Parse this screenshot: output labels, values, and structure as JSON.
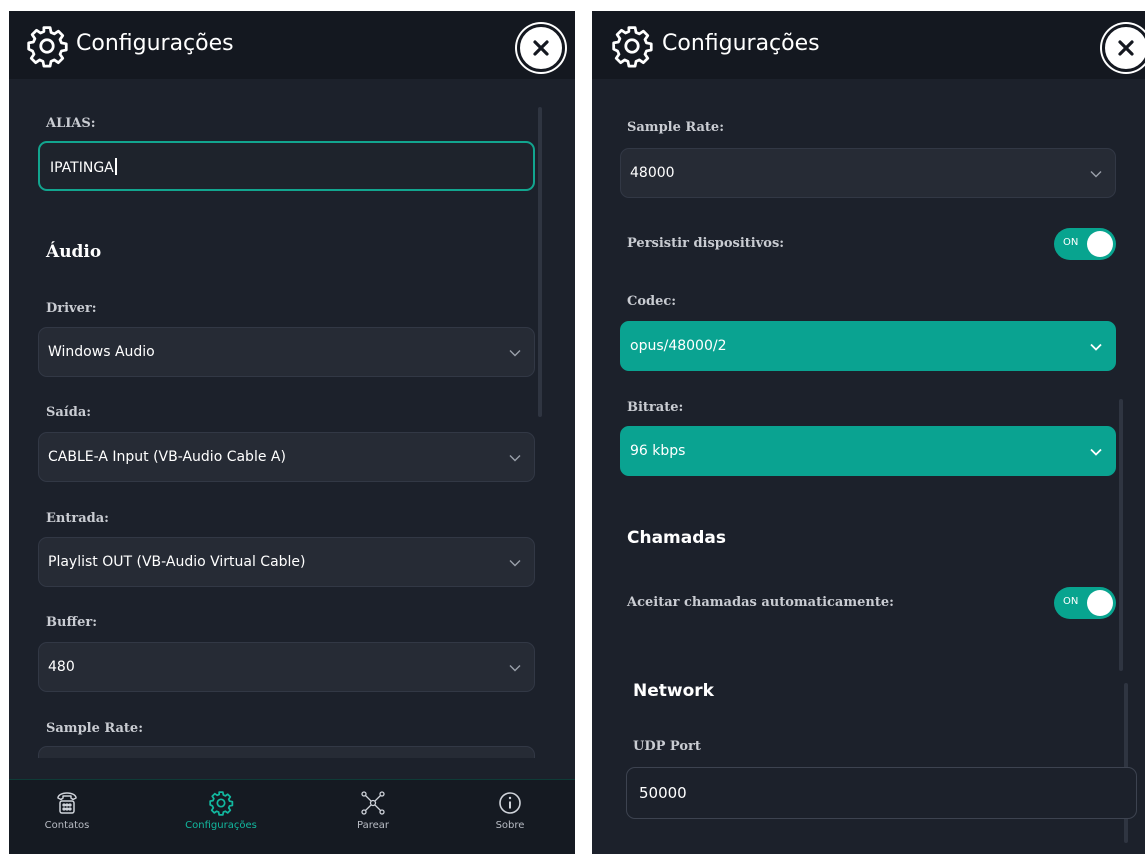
{
  "left": {
    "header": {
      "title": "Configurações",
      "icon": "gear-icon",
      "close_icon": "close-icon"
    },
    "alias": {
      "label": "ALIAS:",
      "value": "IPATINGA"
    },
    "audio_section": "Áudio",
    "driver": {
      "label": "Driver:",
      "value": "Windows Audio"
    },
    "saida": {
      "label": "Saída:",
      "value": "CABLE-A Input (VB-Audio Cable A)"
    },
    "entrada": {
      "label": "Entrada:",
      "value": "Playlist OUT (VB-Audio Virtual Cable)"
    },
    "buffer": {
      "label": "Buffer:",
      "value": "480"
    },
    "sample_rate": {
      "label": "Sample Rate:"
    },
    "nav": [
      {
        "label": "Contatos",
        "icon": "phone-icon",
        "active": false
      },
      {
        "label": "Configurações",
        "icon": "gear-icon",
        "active": true
      },
      {
        "label": "Parear",
        "icon": "network-icon",
        "active": false
      },
      {
        "label": "Sobre",
        "icon": "info-icon",
        "active": false
      }
    ]
  },
  "right": {
    "header": {
      "title": "Configurações",
      "icon": "gear-icon",
      "close_icon": "close-icon"
    },
    "sample_rate": {
      "label": "Sample Rate:",
      "value": "48000"
    },
    "persistir": {
      "label": "Persistir dispositivos:",
      "toggle": "ON",
      "on": true
    },
    "codec": {
      "label": "Codec:",
      "value": "opus/48000/2"
    },
    "bitrate": {
      "label": "Bitrate:",
      "value": "96 kbps"
    },
    "chamadas_section": "Chamadas",
    "aceitar": {
      "label": "Aceitar chamadas automaticamente:",
      "toggle": "ON",
      "on": true
    },
    "network_section": "Network",
    "udp_port": {
      "label": "UDP Port",
      "value": "50000"
    }
  },
  "colors": {
    "accent": "#0aa391",
    "background": "#1c212b",
    "header": "#141820"
  }
}
